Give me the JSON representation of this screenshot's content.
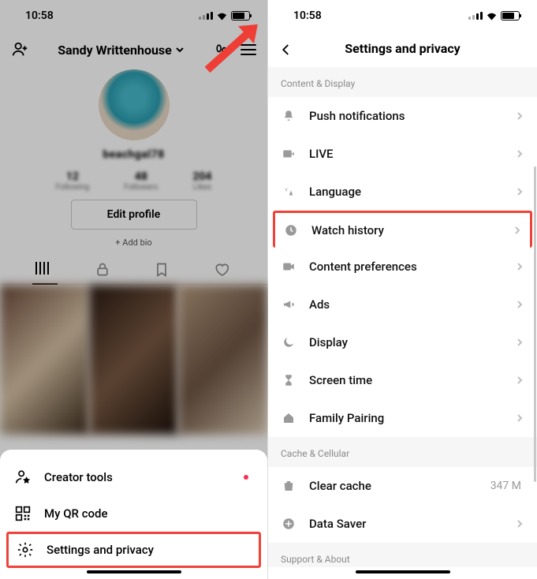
{
  "statusbar": {
    "time": "10:58"
  },
  "left": {
    "username": "Sandy Writtenhouse",
    "handle": "beachgal78",
    "stats": [
      {
        "num": "12",
        "lab": "Following"
      },
      {
        "num": "48",
        "lab": "Followers"
      },
      {
        "num": "204",
        "lab": "Likes"
      }
    ],
    "edit_profile": "Edit profile",
    "add_bio": "+ Add bio",
    "sheet": {
      "creator_tools": "Creator tools",
      "qr": "My QR code",
      "settings": "Settings and privacy"
    }
  },
  "right": {
    "title": "Settings and privacy",
    "sections": {
      "content_display": "Content & Display",
      "cache_cellular": "Cache & Cellular",
      "support_about": "Support & About"
    },
    "rows": {
      "push": "Push notifications",
      "live": "LIVE",
      "language": "Language",
      "watch_history": "Watch history",
      "content_pref": "Content preferences",
      "ads": "Ads",
      "display": "Display",
      "screen_time": "Screen time",
      "family": "Family Pairing",
      "clear_cache": "Clear cache",
      "clear_cache_val": "347 M",
      "data_saver": "Data Saver"
    }
  }
}
